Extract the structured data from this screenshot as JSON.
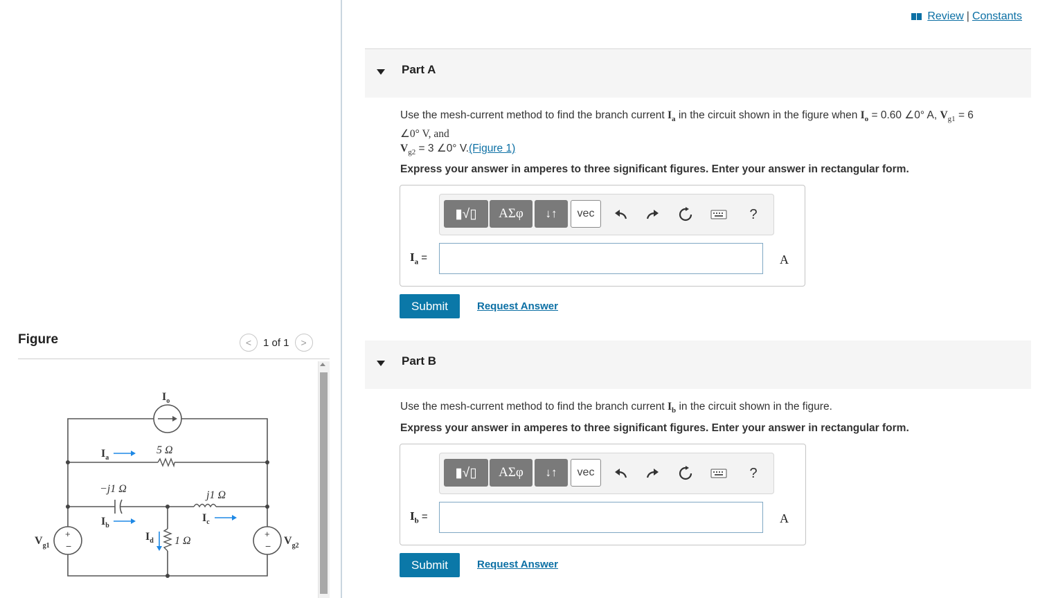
{
  "figure_panel": {
    "heading": "Figure",
    "pager": "1 of 1",
    "prev_glyph": "<",
    "next_glyph": ">",
    "circuit_labels": {
      "io": "I",
      "io_sub": "o",
      "ia": "I",
      "ia_sub": "a",
      "r5": "5 Ω",
      "cap": "−j1 Ω",
      "ind": "j1 Ω",
      "ib": "I",
      "ib_sub": "b",
      "ic": "I",
      "ic_sub": "c",
      "id": "I",
      "id_sub": "d",
      "r1": "1 Ω",
      "vg1": "V",
      "vg1_sub": "g1",
      "vg2": "V",
      "vg2_sub": "g2"
    }
  },
  "top_links": {
    "review": "Review",
    "separator": "|",
    "constants": "Constants"
  },
  "part_a": {
    "title": "Part A",
    "question_line1_pre": "Use the mesh-current method to find the branch current ",
    "question_line1_var": "I",
    "question_line1_var_sub": "a",
    "question_line1_mid": " in the circuit shown in the figure when ",
    "io_expr": "I",
    "io_sub": "o",
    "io_value": " = 0.60 ∠0° A, ",
    "vg1_expr": "V",
    "vg1_sub": "g1",
    "vg1_value": " = 6",
    "question_line2": "∠0° V, and",
    "vg2_expr": "V",
    "vg2_sub": "g2",
    "vg2_value": " = 3 ∠0° V.",
    "figure_link": "(Figure 1)",
    "instruction": "Express your answer in amperes to three significant figures. Enter your answer in rectangular form.",
    "answer_label": "I",
    "answer_label_sub": "a",
    "answer_eq": " =",
    "answer_value": "",
    "unit": "A",
    "submit": "Submit",
    "request": "Request Answer"
  },
  "part_b": {
    "title": "Part B",
    "question_pre": "Use the mesh-current method to find the branch current ",
    "question_var": "I",
    "question_var_sub": "b",
    "question_post": " in the circuit shown in the figure.",
    "instruction": "Express your answer in amperes to three significant figures. Enter your answer in rectangular form.",
    "answer_label": "I",
    "answer_label_sub": "b",
    "answer_eq": " =",
    "answer_value": "",
    "unit": "A",
    "submit": "Submit",
    "request": "Request Answer"
  },
  "toolbar": {
    "sqrt_glyph": "▮√▯",
    "greek": "ΑΣφ",
    "arrows": "↓↑",
    "vec": "vec",
    "help": "?",
    "icons": [
      "undo-icon",
      "redo-icon",
      "reset-icon",
      "keyboard-icon",
      "help-icon"
    ]
  },
  "colors": {
    "accent": "#0b78a8",
    "link": "#0b6fa4",
    "circuit_blue": "#1e88e5"
  }
}
